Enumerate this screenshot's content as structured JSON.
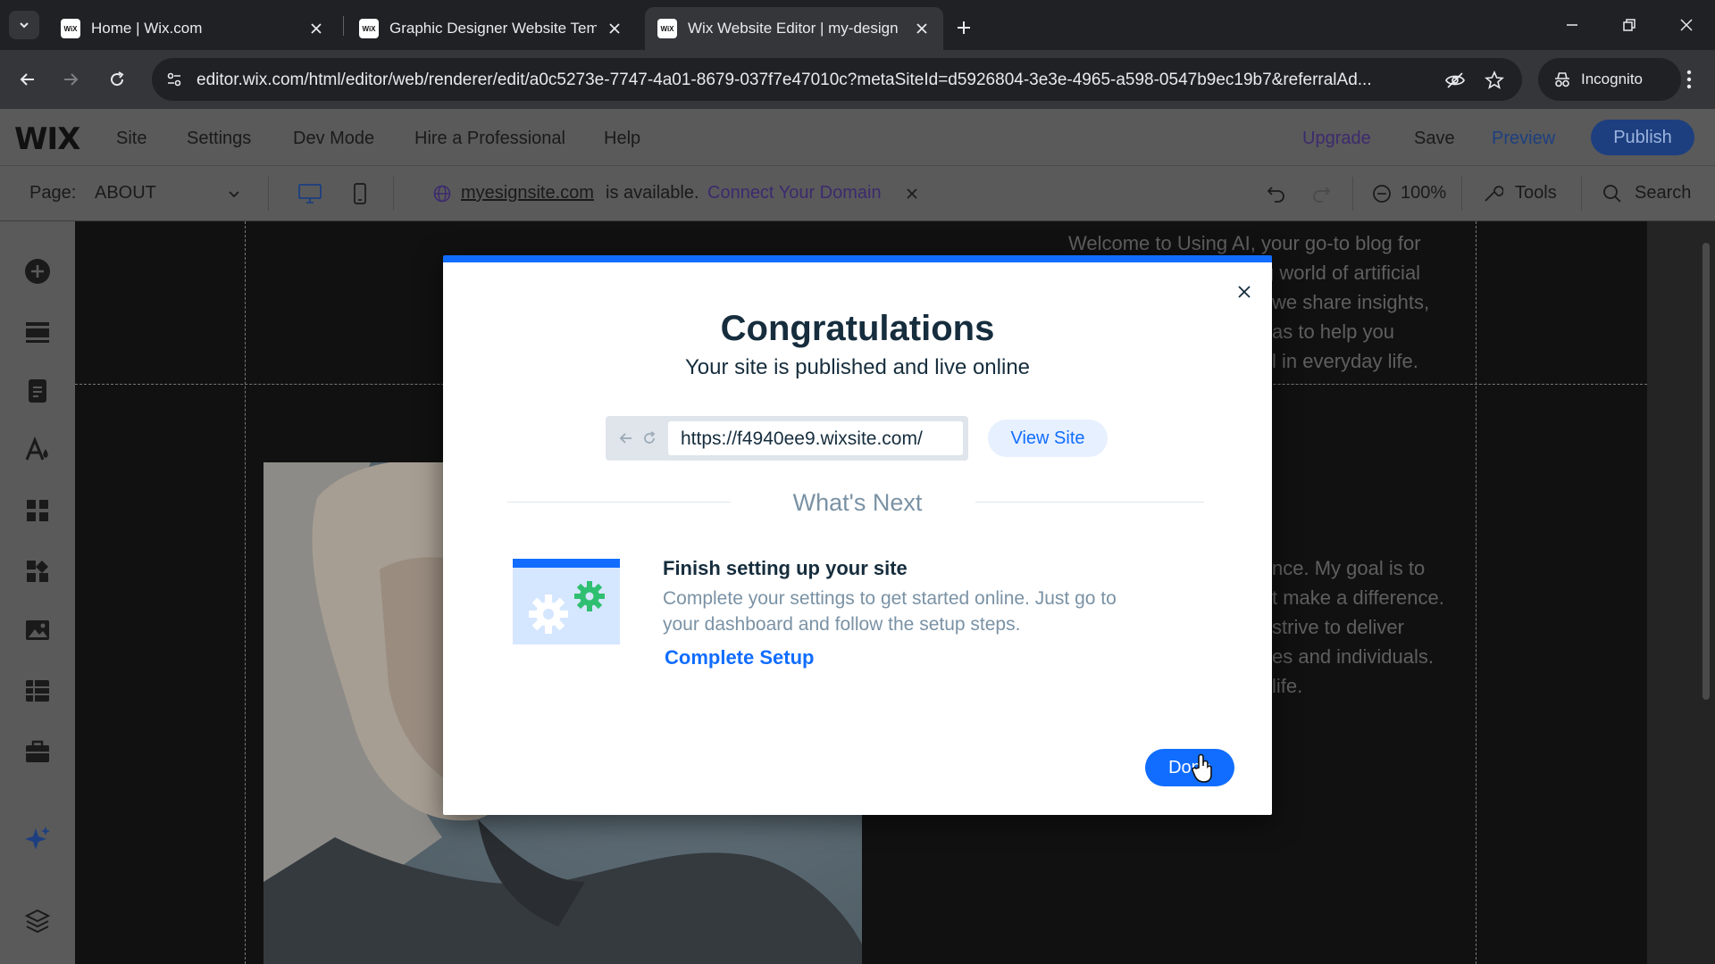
{
  "browser": {
    "tabs": [
      {
        "title": "Home | Wix.com",
        "favicon": "WiX"
      },
      {
        "title": "Graphic Designer Website Temp",
        "favicon": "WiX"
      },
      {
        "title": "Wix Website Editor | my-design",
        "favicon": "WiX"
      }
    ],
    "url": "editor.wix.com/html/editor/web/renderer/edit/a0c5273e-7747-4a01-8679-037f7e47010c?metaSiteId=d5926804-3e3e-4965-a598-0547b9ec19b7&referralAd...",
    "incognito_label": "Incognito"
  },
  "editor": {
    "logo": "WIX",
    "menu": [
      "Site",
      "Settings",
      "Dev Mode",
      "Hire a Professional",
      "Help"
    ],
    "upgrade": "Upgrade",
    "save": "Save",
    "preview": "Preview",
    "publish": "Publish",
    "page_label": "Page:",
    "page_value": "ABOUT",
    "domain_name": "myesignsite.com",
    "domain_status": "is available.",
    "connect_domain": "Connect Your Domain",
    "zoom": "100%",
    "tools": "Tools",
    "search": "Search"
  },
  "canvas": {
    "text_top": [
      "Welcome to Using AI, your go-to blog for",
      "g world of artificial",
      "we share insights,",
      "as to help you",
      "l in everyday life."
    ],
    "text_mid": [
      "nce. My goal is to",
      "t make a difference.",
      "strive to deliver",
      "es and individuals.",
      "life."
    ]
  },
  "modal": {
    "title": "Congratulations",
    "subtitle": "Your site is published and live online",
    "site_url": "https://f4940ee9.wixsite.com/",
    "view_site": "View Site",
    "whats_next": "What's Next",
    "setup_title": "Finish setting up your site",
    "setup_desc_line1": "Complete your settings to get started online. Just go to",
    "setup_desc_line2": "your dashboard and follow the setup steps.",
    "setup_link": "Complete Setup",
    "done": "Done"
  },
  "colors": {
    "wix_blue": "#116dff",
    "modal_text": "#162d3d",
    "muted_text": "#7a92a5"
  }
}
